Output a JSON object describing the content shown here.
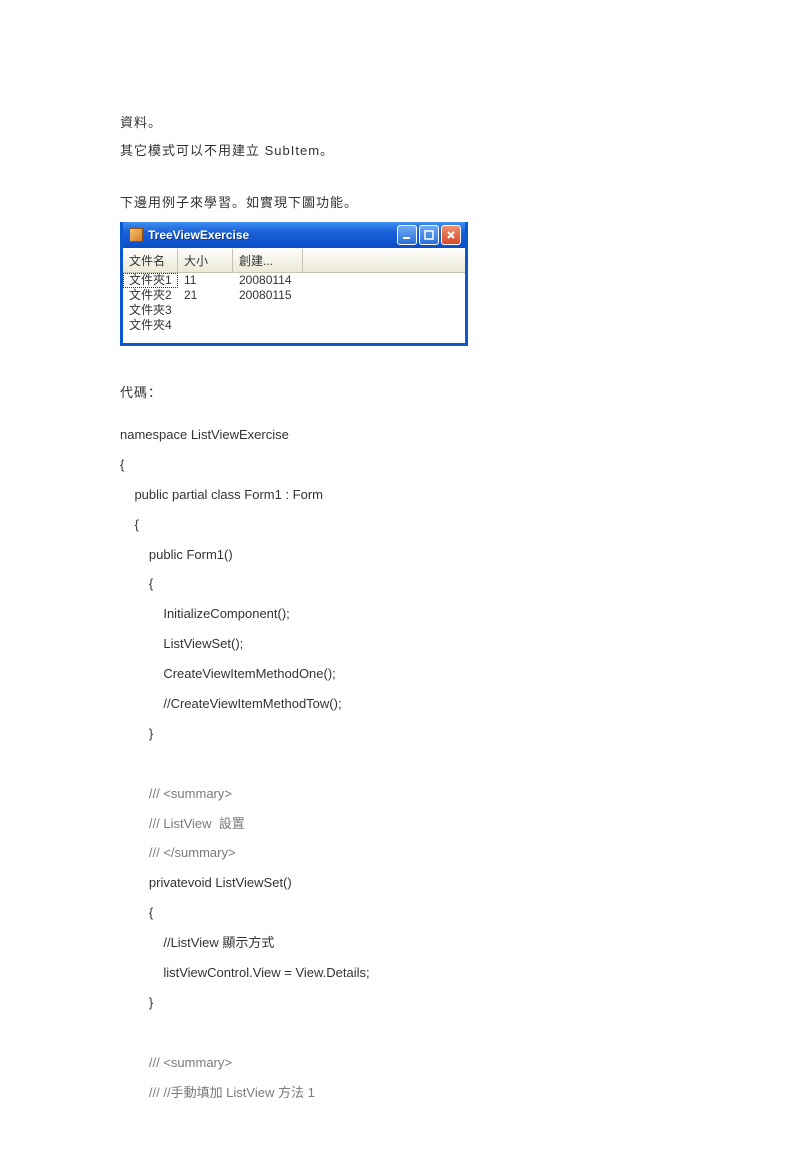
{
  "text": {
    "p1": "資料。",
    "p2": "其它模式可以不用建立 SubItem。",
    "p3": "下邊用例子來學習。如實現下圖功能。",
    "p4": "代碼："
  },
  "window": {
    "title": "TreeViewExercise",
    "columns": {
      "name": "文件名",
      "size": "大小",
      "date": "創建..."
    },
    "rows": [
      {
        "name": "文件夾1",
        "size": "11",
        "date": "20080114",
        "selected": true
      },
      {
        "name": "文件夾2",
        "size": "21",
        "date": "20080115",
        "selected": false
      },
      {
        "name": "文件夾3",
        "size": "",
        "date": "",
        "selected": false
      },
      {
        "name": "文件夾4",
        "size": "",
        "date": "",
        "selected": false
      }
    ]
  },
  "code": {
    "l1": "namespace ListViewExercise",
    "l2": "{",
    "l3": "    public partial class Form1 : Form",
    "l4": "    {",
    "l5": "        public Form1()",
    "l6": "        {",
    "l7": "            InitializeComponent();",
    "l8": "            ListViewSet();",
    "l9": "            CreateViewItemMethodOne();",
    "l10": "            //CreateViewItemMethodTow();",
    "l11": "        }",
    "l12": "",
    "l13": "        /// <summary>",
    "l14": "        /// ListView  設置",
    "l15": "        /// </summary>",
    "l16": "        privatevoid ListViewSet()",
    "l17": "        {",
    "l18": "            //ListView 顯示方式",
    "l19": "            listViewControl.View = View.Details;",
    "l20": "        }",
    "l21": "",
    "l22": "        /// <summary>",
    "l23": "        /// //手動填加 ListView 方法 1"
  }
}
